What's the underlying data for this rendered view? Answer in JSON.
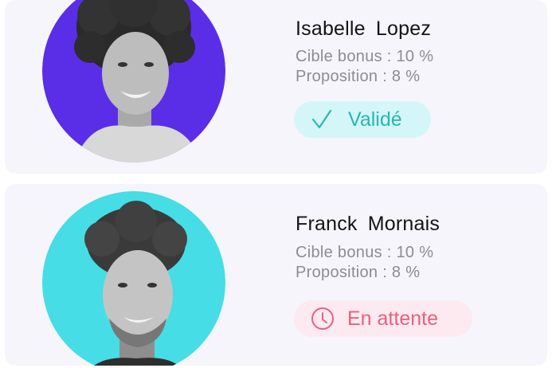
{
  "colors": {
    "card_background": "#f5f5fb",
    "avatar_1_background": "#5a2ee6",
    "avatar_2_background": "#46dde6",
    "valid_badge_bg": "#d4f6f8",
    "valid_badge_text": "#28b8b0",
    "pending_badge_bg": "#fdeaf0",
    "pending_badge_text": "#e8607f"
  },
  "employees": [
    {
      "name": "Isabelle  Lopez",
      "target_label": "Cible bonus : 10 %",
      "proposal_label": "Proposition : 8 %",
      "status_label": "Validé",
      "status_icon": "check-icon"
    },
    {
      "name": "Franck  Mornais",
      "target_label": "Cible bonus : 10 %",
      "proposal_label": "Proposition : 8 %",
      "status_label": "En attente",
      "status_icon": "clock-icon"
    }
  ]
}
